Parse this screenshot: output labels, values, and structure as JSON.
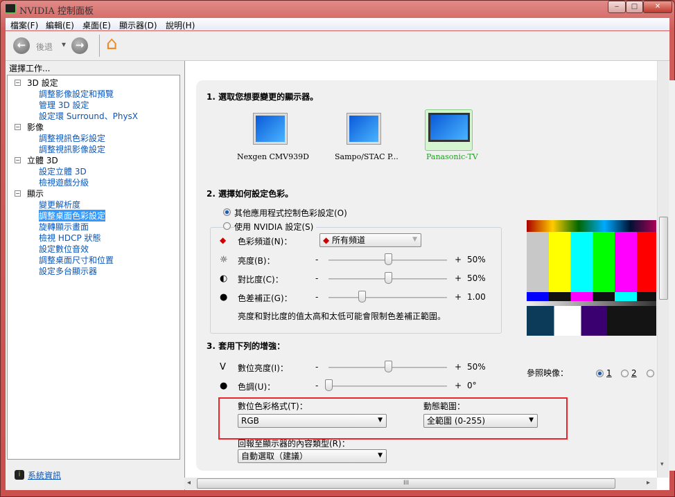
{
  "window": {
    "title": "NVIDIA 控制面板",
    "min": "‒",
    "max": "□",
    "close": "✕"
  },
  "menu": [
    "檔案(F)",
    "編輯(E)",
    "桌面(E)",
    "顯示器(D)",
    "說明(H)"
  ],
  "toolbar": {
    "back": "後退",
    "back_arrow": "←",
    "fwd_arrow": "→",
    "dropdown": "▾",
    "home": "⌂"
  },
  "sidebar": {
    "heading": "選擇工作...",
    "categories": [
      {
        "label": "3D 設定",
        "items": [
          "調整影像設定和預覽",
          "管理 3D 設定",
          "設定環 Surround、PhysX"
        ]
      },
      {
        "label": "影像",
        "items": [
          "調整視訊色彩設定",
          "調整視訊影像設定"
        ]
      },
      {
        "label": "立體 3D",
        "items": [
          "設定立體 3D",
          "檢視遊戲分級"
        ]
      },
      {
        "label": "顯示",
        "items": [
          "變更解析度",
          "調整桌面色彩設定",
          "旋轉顯示畫面",
          "檢視 HDCP 狀態",
          "設定數位音效",
          "調整桌面尺寸和位置",
          "設定多台顯示器"
        ]
      }
    ],
    "selected": "調整桌面色彩設定",
    "expand": "−",
    "system_info": "系統資訊"
  },
  "section1": {
    "title": "1. 選取您想要變更的顯示器。",
    "displays": [
      "Nexgen CMV939D",
      "Sampo/STAC P...",
      "Panasonic-TV"
    ],
    "selected": "Panasonic-TV"
  },
  "section2": {
    "title": "2. 選擇如何設定色彩。",
    "radio_other": "其他應用程式控制色彩設定(O)",
    "radio_nvidia": "使用 NVIDIA 設定(S)",
    "selected": "other",
    "channel_label": "色彩頻道(N)：",
    "channel_value": "所有頻道",
    "sliders": [
      {
        "label": "亮度(B)：",
        "value": "50%",
        "fraction": 0.5
      },
      {
        "label": "對比度(C)：",
        "value": "50%",
        "fraction": 0.5
      },
      {
        "label": "色差補正(G)：",
        "value": "1.00",
        "fraction": 0.28
      }
    ],
    "minus": "-",
    "plus": "+",
    "note": "亮度和對比度的值太高和太低可能會限制色差補正範圍。"
  },
  "section3": {
    "title": "3. 套用下列的增強：",
    "sliders": [
      {
        "label": "數位亮度(I)：",
        "value": "50%",
        "fraction": 0.5
      },
      {
        "label": "色調(U)：",
        "value": "0°",
        "fraction": 0.0
      }
    ],
    "color_format_label": "數位色彩格式(T)：",
    "color_format_value": "RGB",
    "dynamic_range_label": "動態範圍：",
    "dynamic_range_value": "全範圍 (0-255)",
    "content_type_label": "回報至顯示器的內容類型(R)：",
    "content_type_value": "自動選取（建議）"
  },
  "reference": {
    "label": "參照映像：",
    "options": [
      "1",
      "2"
    ],
    "selected": "1"
  },
  "colors": {
    "highlight": "#e8262b",
    "selected_green": "#1aa31a"
  },
  "scroll": {
    "grip": "III",
    "left": "◂",
    "right": "▸",
    "down": "▾"
  }
}
